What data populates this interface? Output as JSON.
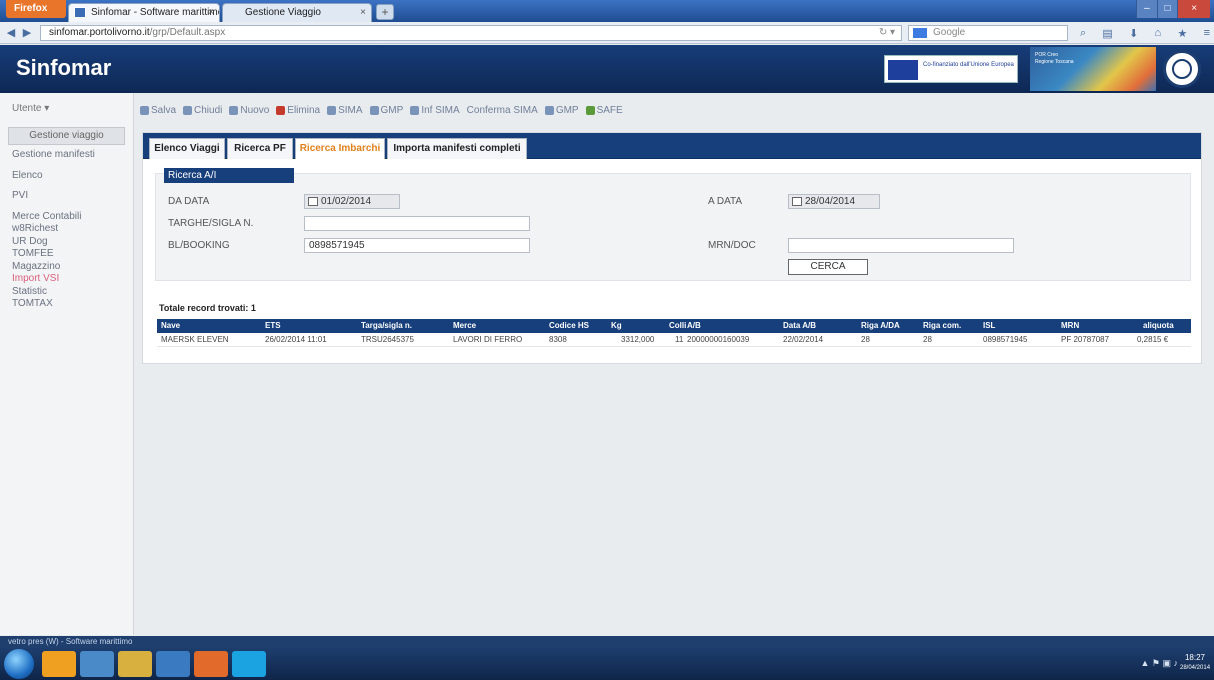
{
  "browser": {
    "firefox_label": "Firefox",
    "tabs": [
      {
        "label": "Sinfomar - Software marittimo"
      },
      {
        "label": "Gestione Viaggio"
      }
    ],
    "new_tab": "+",
    "url_host": "sinfomar.portolivorno.it",
    "url_path": "/grp/Default.aspx",
    "search_placeholder": "Google"
  },
  "app": {
    "brand": "Sinfomar",
    "eu_text": "Co-finanziato dall'Unione Europea Fondo Europeo Sviluppo Regionale",
    "logo_text": "POR Creo Regione Toscana"
  },
  "sidebar": {
    "top": "Utente ▾",
    "active": "Gestione viaggio",
    "items": [
      "Gestione manifesti",
      "Elenco",
      "PVI",
      "Merce Contabili",
      "w8Richest",
      "UR Dog",
      "TOMFEE",
      "Magazzino",
      "Import VSI",
      "Statistic",
      "TOMTAX"
    ]
  },
  "toolbar": {
    "buttons": [
      "Salva",
      "Chiudi",
      "Nuovo",
      "Elimina",
      "SIMA",
      "GMP",
      "Inf SIMA",
      "Conferma SIMA",
      "GMP",
      "SAFE"
    ]
  },
  "tabs": [
    {
      "label": "Elenco Viaggi"
    },
    {
      "label": "Ricerca PF"
    },
    {
      "label": "Ricerca Imbarchi"
    },
    {
      "label": "Importa manifesti completi"
    }
  ],
  "search": {
    "legend": "Ricerca A/I",
    "da_data_label": "DA DATA",
    "da_data_value": "01/02/2014",
    "a_data_label": "A DATA",
    "a_data_value": "28/04/2014",
    "targa_label": "TARGHE/SIGLA N.",
    "targa_value": "",
    "booking_label": "BL/BOOKING",
    "booking_value": "0898571945",
    "mrn_label": "MRN/DOC",
    "mrn_value": "",
    "cerca_button": "CERCA"
  },
  "results": {
    "total_label": "Totale record trovati: 1",
    "columns": [
      "Nave",
      "ETS",
      "Targa/sigla n.",
      "Merce",
      "Codice HS",
      "Kg",
      "Colli",
      "A/B",
      "Data A/B",
      "Riga A/DA",
      "Riga com.",
      "ISL",
      "MRN",
      "aliquota"
    ],
    "rows": [
      [
        "MAERSK ELEVEN",
        "26/02/2014 11:01",
        "TRSU2645375",
        "LAVORI DI FERRO",
        "8308",
        "3312,000",
        "11",
        "20000000160039",
        "22/02/2014",
        "28",
        "28",
        "0898571945",
        "PF 20787087",
        "0,2815 €"
      ]
    ]
  },
  "status": {
    "text": "vetro pres (W) - Software marittimo",
    "time": "18:27",
    "date": "28/04/2014"
  }
}
